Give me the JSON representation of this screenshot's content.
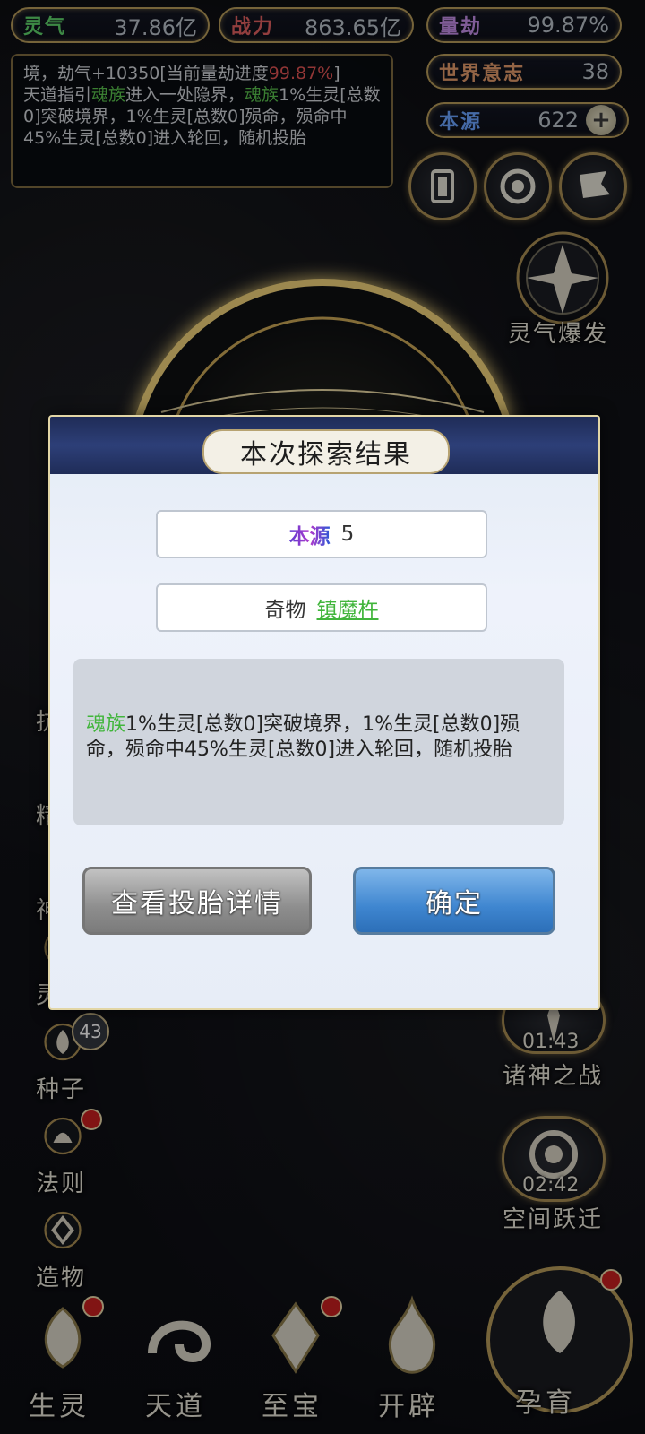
{
  "stats": {
    "lingqi": {
      "label": "灵气",
      "value": "37.86亿"
    },
    "zhanli": {
      "label": "战力",
      "value": "863.65亿"
    },
    "liangjie": {
      "label": "量劫",
      "value": "99.87%"
    },
    "shijie": {
      "label": "世界意志",
      "value": "38"
    },
    "benyuan": {
      "label": "本源",
      "value": "622"
    }
  },
  "log": {
    "line1_pre": "境，劫气+10350[当前量劫进度",
    "line1_red": "99.87%",
    "line1_post": "]",
    "line2_pre": "天道指引",
    "line2_green1": "魂族",
    "line2_mid": "进入一处隐界，",
    "line2_green2": "魂族",
    "line2_post": "1%生",
    "rest": "灵[总数0]突破境界，1%生灵[总数0]殒命，殒命中45%生灵[总数0]进入轮回，随机投胎"
  },
  "right_menu": {
    "lingqi_baofa": "灵气爆发",
    "zhushen_timer": "01:43",
    "zhushen_label": "诸神之战",
    "kongjian_timer": "02:42",
    "kongjian_label": "空间跃迁",
    "yunyu_label": "孕育"
  },
  "left_menu": {
    "partial1": "抗",
    "partial2": "精",
    "partial3": "神",
    "lingzhi": "灵植",
    "zhongzi": "种子",
    "zhongzi_badge": "43",
    "faze": "法则",
    "zaowu": "造物"
  },
  "bottom_nav": {
    "shengling": "生灵",
    "tiandao": "天道",
    "zhibao": "至宝",
    "kaipi": "开辟"
  },
  "modal": {
    "title": "本次探索结果",
    "reward1_label": "本源",
    "reward1_value": "5",
    "reward2_label": "奇物",
    "reward2_link": "镇魔杵",
    "desc_green": "魂族",
    "desc_rest": "1%生灵[总数0]突破境界，1%生灵[总数0]殒命，殒命中45%生灵[总数0]进入轮回，随机投胎",
    "btn_view": "查看投胎详情",
    "btn_ok": "确定"
  }
}
